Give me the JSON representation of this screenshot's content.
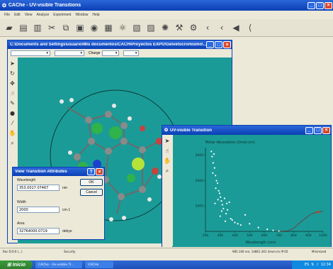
{
  "main_window": {
    "title": "CAChe - UV-visible Transitions",
    "menu": [
      "File",
      "Edit",
      "View",
      "Analyze",
      "Experiment",
      "Window",
      "Help"
    ],
    "toolbar_icons": [
      "open-folder-icon",
      "save-icon",
      "print-icon",
      "cut-icon",
      "copy-icon",
      "paste-icon",
      "info-icon",
      "graph-icon",
      "molecule-icon",
      "chart-icon",
      "plot-icon",
      "orbital-icon",
      "build-icon",
      "tools-icon",
      "arrow-left-icon",
      "arrow-left2-icon",
      "back-icon",
      "bracket-icon"
    ]
  },
  "doc_window": {
    "title": "C:\\Documents and Settings\\usuario\\Mis documentos\\CACH\\Proyectos EXPO\\Gelvetocromismo\\...",
    "charge_label": "Charge",
    "tools": [
      "select-arrow-icon",
      "rotate-icon",
      "translate-icon",
      "pointer-icon",
      "pen-icon",
      "atom-icon",
      "bond-icon",
      "hand-icon",
      "magnifier-icon"
    ]
  },
  "uv_window": {
    "title": "UV-visible Transition",
    "tools": [
      "select-arrow-icon",
      "pointer-icon",
      "hand-icon",
      "magnifier-icon"
    ]
  },
  "chart_data": {
    "type": "scatter",
    "title": "Molar Absorption (l/mol-cm)",
    "xlabel": "Wavelength (nm)",
    "ylabel": "",
    "x_ticks": [
      200,
      300,
      400,
      500,
      600,
      700,
      800,
      900,
      1000
    ],
    "y_ticks": [
      1000,
      2000,
      3000
    ],
    "xlim": [
      200,
      1000
    ],
    "ylim": [
      0,
      3300
    ],
    "series": [
      {
        "points": [
          [
            240,
            3150
          ],
          [
            245,
            2950
          ],
          [
            252,
            2700
          ],
          [
            258,
            3050
          ],
          [
            262,
            2500
          ],
          [
            268,
            2200
          ],
          [
            275,
            2000
          ],
          [
            282,
            1900
          ],
          [
            290,
            1600
          ],
          [
            296,
            1500
          ],
          [
            302,
            1350
          ],
          [
            308,
            1200
          ],
          [
            315,
            1050
          ],
          [
            322,
            900
          ],
          [
            330,
            1300
          ],
          [
            340,
            700
          ],
          [
            350,
            850
          ],
          [
            362,
            1150
          ],
          [
            372,
            500
          ],
          [
            382,
            450
          ],
          [
            400,
            350
          ],
          [
            420,
            300
          ],
          [
            440,
            250
          ],
          [
            470,
            650
          ],
          [
            500,
            300
          ],
          [
            560,
            150
          ],
          [
            620,
            80
          ],
          [
            660,
            40
          ],
          [
            700,
            10
          ],
          [
            250,
            2300
          ],
          [
            270,
            1700
          ],
          [
            285,
            1250
          ],
          [
            310,
            800
          ],
          [
            335,
            400
          ],
          [
            265,
            1100
          ],
          [
            300,
            600
          ],
          [
            345,
            1100
          ]
        ]
      },
      {
        "line": [
          [
            700,
            0
          ],
          [
            760,
            20
          ],
          [
            800,
            120
          ],
          [
            840,
            330
          ],
          [
            880,
            520
          ],
          [
            920,
            690
          ],
          [
            960,
            760
          ],
          [
            1000,
            790
          ]
        ]
      }
    ],
    "marker": [
      965,
      760
    ]
  },
  "attr_dialog": {
    "title": "View Transition Attributes",
    "wavelength_label": "Wavelength",
    "wavelength_value": "353.0017.07467",
    "wavelength_unit": "nm",
    "width_label": "Width",
    "width_value": "2000",
    "width_unit": "cm-1",
    "area_label": "Area",
    "area_value": "32764000.0719",
    "area_unit": "debye",
    "ok_label": "OK",
    "cancel_label": "Cancel"
  },
  "statusbar": {
    "left": "Rec D:0:0 (...)",
    "middle": "Security",
    "right": "985.100 nm, 14861.361 l/mol-cm  IP:05",
    "far_right": "Minimized"
  },
  "taskbar": {
    "start_label": "Inicio",
    "tasks": [
      "CAChe - Uv-visible Tr...",
      "CACHe"
    ],
    "tray_icons": [
      "language-icon",
      "network-icon",
      "volume-icon"
    ],
    "clock": "12:34"
  }
}
